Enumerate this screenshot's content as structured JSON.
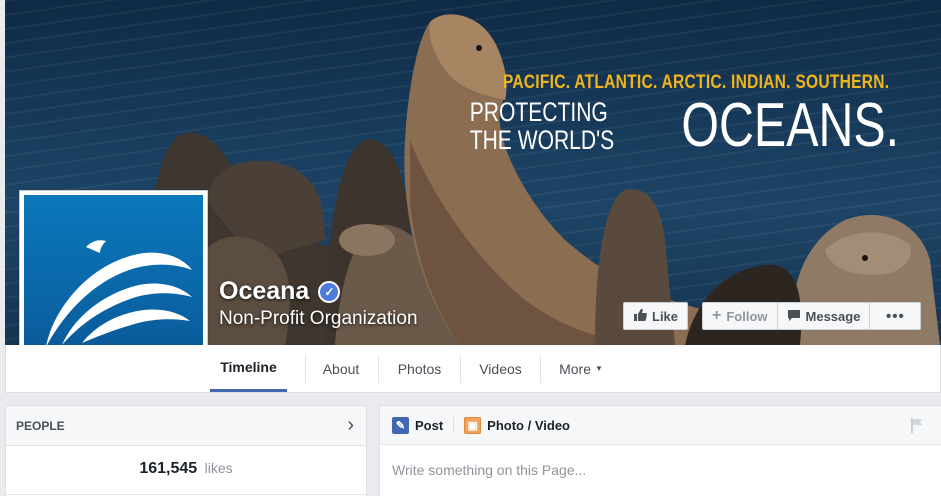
{
  "cover": {
    "tagline": "PACIFIC. ATLANTIC. ARCTIC. INDIAN. SOUTHERN.",
    "headline_line1": "PROTECTING",
    "headline_line2": "THE WORLD'S",
    "headline_big": "OCEANS."
  },
  "page": {
    "name": "Oceana",
    "category": "Non-Profit Organization",
    "verified_icon": "check-icon"
  },
  "actions": {
    "like": "Like",
    "follow": "Follow",
    "message": "Message",
    "more": "•••"
  },
  "tabs": [
    {
      "label": "Timeline",
      "active": true
    },
    {
      "label": "About"
    },
    {
      "label": "Photos"
    },
    {
      "label": "Videos"
    },
    {
      "label": "More"
    }
  ],
  "people": {
    "title": "PEOPLE",
    "likes_count": "161,545",
    "likes_label": "likes"
  },
  "composer": {
    "post_label": "Post",
    "photo_label": "Photo / Video",
    "placeholder": "Write something on this Page..."
  },
  "colors": {
    "brand_blue": "#4267b2",
    "tagline_yellow": "#f0b41c",
    "logo_blue": "#0a6fb3"
  }
}
